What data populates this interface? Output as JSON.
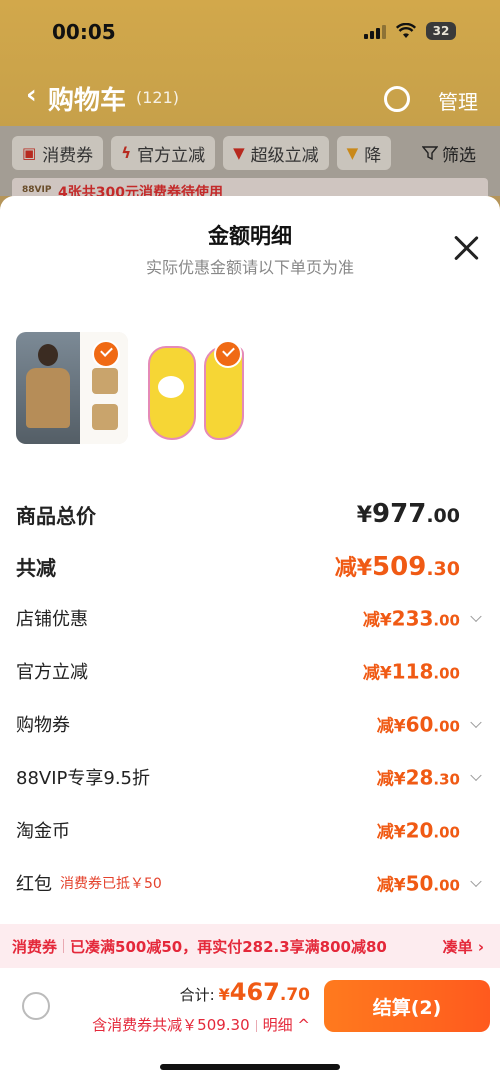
{
  "status_bar": {
    "time": "00:05",
    "battery": "32"
  },
  "nav": {
    "back_icon": "chevron-left-icon",
    "title": "购物车",
    "count": "(121)",
    "manage": "管理"
  },
  "chips": [
    {
      "icon": "coupon-icon",
      "label": "消费券"
    },
    {
      "icon": "lightning-icon",
      "label": "官方立减"
    },
    {
      "icon": "arrow-down-icon",
      "label": "超级立减"
    },
    {
      "icon": "arrow-down-icon",
      "label": "降"
    }
  ],
  "filter": {
    "label": "筛选"
  },
  "bg_banner": {
    "badge": "88VIP",
    "text": "4张共300元消费券待使用"
  },
  "sheet": {
    "title": "金额明细",
    "subtitle": "实际优惠金额请以下单页为准",
    "rows": [
      {
        "label": "商品总价",
        "prefix": "¥",
        "int": "977",
        "dec": ".00"
      },
      {
        "label": "共减",
        "prefix": "减¥",
        "int": "509",
        "dec": ".30"
      },
      {
        "label": "店铺优惠",
        "prefix": "减¥",
        "int": "233",
        "dec": ".00"
      },
      {
        "label": "官方立减",
        "prefix": "减¥",
        "int": "118",
        "dec": ".00"
      },
      {
        "label": "购物券",
        "prefix": "减¥",
        "int": "60",
        "dec": ".00"
      },
      {
        "label": "88VIP专享9.5折",
        "prefix": "减¥",
        "int": "28",
        "dec": ".30"
      },
      {
        "label": "淘金币",
        "prefix": "减¥",
        "int": "20",
        "dec": ".00"
      },
      {
        "label": "红包",
        "note": "消费券已抵￥50",
        "prefix": "减¥",
        "int": "50",
        "dec": ".00"
      }
    ]
  },
  "promo": {
    "tag": "消费券",
    "text": "已凑满500减50，再实付282.3享满800减80",
    "link": "凑单 ›"
  },
  "footer": {
    "total_label": "合计:",
    "total_prefix": "¥",
    "total_int": "467",
    "total_dec": ".70",
    "discount_text": "含消费券共减￥509.30",
    "detail_label": "明细 ^",
    "checkout_label": "结算(2)"
  },
  "colors": {
    "accent": "#f05a14",
    "promo": "#e4283a",
    "header": "#c6a04a"
  }
}
